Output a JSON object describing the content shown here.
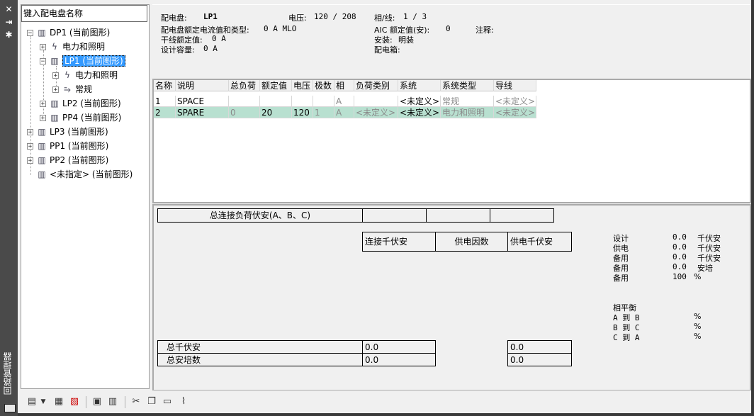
{
  "sidebar": {
    "title": "回路管理器"
  },
  "tree": {
    "search_placeholder": "键入配电盘名称",
    "nodes": [
      {
        "label": "DP1 (当前图形)"
      },
      {
        "label": "电力和照明"
      },
      {
        "label": "LP1 (当前图形)"
      },
      {
        "label": "电力和照明"
      },
      {
        "label": "常规"
      },
      {
        "label": "LP2 (当前图形)"
      },
      {
        "label": "PP4 (当前图形)"
      },
      {
        "label": "LP3 (当前图形)"
      },
      {
        "label": "PP1 (当前图形)"
      },
      {
        "label": "PP2 (当前图形)"
      },
      {
        "label": "<未指定> (当前图形)"
      }
    ]
  },
  "info": {
    "panel_label": "配电盘:",
    "panel_value": "LP1",
    "voltage_label": "电压:",
    "voltage_value": "120 / 208",
    "phase_label": "相/线:",
    "phase_value": "1 / 3",
    "rating_label": "配电盘额定电流值和类型:",
    "rating_value": "0 A MLO",
    "aic_label": "AIC 额定值(安):",
    "aic_value": "0",
    "notes_label": "注释:",
    "main_rating_label": "干线额定值:",
    "main_rating_value": "0 A",
    "mount_label": "安装:",
    "mount_value": "明装",
    "design_cap_label": "设计容量:",
    "design_cap_value": "0 A",
    "enclosure_label": "配电箱:"
  },
  "grid": {
    "headers": [
      "名称",
      "说明",
      "总负荷",
      "额定值",
      "电压",
      "极数",
      "相",
      "负荷类别",
      "系统",
      "系统类型",
      "导线"
    ],
    "rows": [
      [
        "1",
        "SPACE",
        "",
        "",
        "",
        "",
        "A",
        "",
        "<未定义>",
        "常规",
        "<未定义>"
      ],
      [
        "2",
        "SPARE",
        "0",
        "20",
        "120",
        "1",
        "A",
        "<未定义>",
        "<未定义>",
        "电力和照明",
        "<未定义>"
      ]
    ]
  },
  "summary": {
    "total_load_label": "总连接负荷伏安(A、B、C)",
    "col_connected": "连接千伏安",
    "col_demand_factor": "供电因数",
    "col_demand_kva": "供电千伏安",
    "total_kva_label": "总千伏安",
    "total_amps_label": "总安培数",
    "total_kva_value": "0.0",
    "total_amps_value": "0.0",
    "total_kva_demand": "0.0",
    "total_amps_demand": "0.0",
    "stats": [
      {
        "label": "设计",
        "value": "0.0",
        "unit": "千伏安"
      },
      {
        "label": "供电",
        "value": "0.0",
        "unit": "千伏安"
      },
      {
        "label": "备用",
        "value": "0.0",
        "unit": "千伏安"
      },
      {
        "label": "备用",
        "value": "0.0",
        "unit": "安培"
      },
      {
        "label": "备用",
        "value": "100",
        "unit": "%"
      }
    ],
    "balance_title": "相平衡",
    "balance": [
      {
        "label": "A 到 B",
        "unit": "%"
      },
      {
        "label": "B 到 C",
        "unit": "%"
      },
      {
        "label": "C 到 A",
        "unit": "%"
      }
    ]
  },
  "colors": {
    "selected_row": "#b8e0d0",
    "tree_selection": "#3399ff"
  }
}
